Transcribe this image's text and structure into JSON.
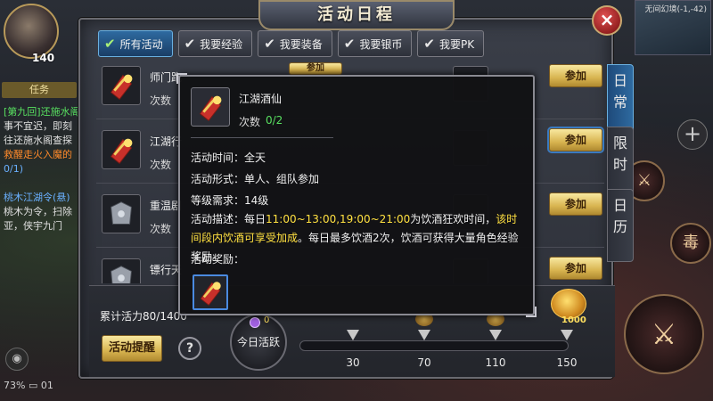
{
  "hud": {
    "player_level": "140",
    "quest_button": "任务",
    "quest_lines": [
      {
        "text": "[第九回]还施水阁",
        "cls": "g"
      },
      {
        "text": "事不宜迟，即刻",
        "cls": ""
      },
      {
        "text": "往还施水阁查探",
        "cls": ""
      },
      {
        "text": "救醒走火入魔的",
        "cls": "o"
      },
      {
        "text": "0/1)",
        "cls": "bl"
      },
      {
        "text": "",
        "cls": ""
      },
      {
        "text": "桃木江湖令(悬)",
        "cls": "bl"
      },
      {
        "text": "桃木为令，扫除",
        "cls": ""
      },
      {
        "text": "亚，侠宇九门",
        "cls": ""
      }
    ],
    "battery_status": "73%",
    "time_partial": "01",
    "minimap_label": "无间幻境(-1,-42)",
    "skill_label": "毒"
  },
  "panel": {
    "title": "活动日程",
    "close_icon": "×",
    "tabs": [
      {
        "label": "所有活动",
        "active": true
      },
      {
        "label": "我要经验",
        "active": false
      },
      {
        "label": "我要装备",
        "active": false
      },
      {
        "label": "我要银币",
        "active": false
      },
      {
        "label": "我要PK",
        "active": false
      }
    ],
    "side_tabs": [
      {
        "label": "日常",
        "active": true
      },
      {
        "label": "限时",
        "active": false
      },
      {
        "label": "日历",
        "active": false
      }
    ]
  },
  "activities": [
    {
      "name": "师门跑",
      "count_label": "次数",
      "button": "参加",
      "icon": "scroll-icon"
    },
    {
      "name": "江湖行",
      "count_label": "次数",
      "button": "参加",
      "icon": "scroll-icon"
    },
    {
      "name": "重温剧",
      "count_label": "次数",
      "button": "参加",
      "icon": "armor-icon"
    },
    {
      "name": "镖行天",
      "count_label": "",
      "button": "参加",
      "icon": "armor-icon"
    }
  ],
  "hidden_join_label": "参加",
  "tooltip": {
    "title": "江湖酒仙",
    "count_label": "次数",
    "count_value": "0/2",
    "time_line": "活动时间：全天",
    "form_line": "活动形式：单人、组队参加",
    "level_line": "等级需求：14级",
    "desc_prefix": "活动描述：每日",
    "desc_times": "11:00~13:00,19:00~21:00",
    "desc_mid": "为饮酒狂欢时间，",
    "desc_highlight": "该时间段内饮酒可享受加成",
    "desc_suffix": "。每日最多饮酒2次，饮酒可获得大量角色经验奖励。",
    "reward_label": "活动奖励："
  },
  "footer": {
    "vitality_label": "累计活力80/1400",
    "remind_button": "活动提醒",
    "help_icon": "?",
    "daily_label": "今日活跃",
    "daily_value": "0",
    "progress_fraction": 0.0,
    "milestones": [
      "30",
      "70",
      "110",
      "150"
    ],
    "chest_label": "1000"
  },
  "colors": {
    "accent_blue": "#2e6aa0",
    "gold_button": "#d8b450",
    "green_value": "#58e060",
    "highlight_yellow": "#ffe040"
  }
}
